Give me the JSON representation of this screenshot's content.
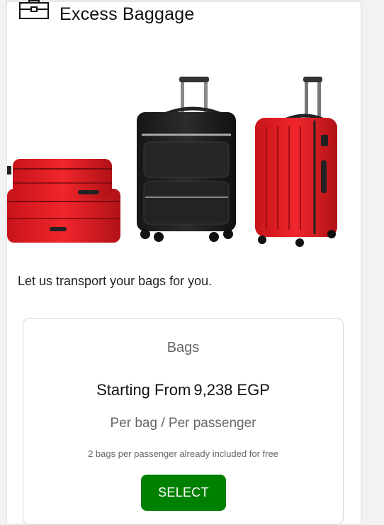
{
  "section": {
    "title": "Excess Baggage",
    "icon": "briefcase-icon",
    "tagline": "Let us transport your bags for you."
  },
  "hero": {
    "image": "luggage-group-illustration"
  },
  "offer": {
    "heading": "Bags",
    "price_prefix": "Starting From",
    "price_amount": "9,238",
    "price_currency": "EGP",
    "per_label": "Per bag / Per passenger",
    "included_note": "2 bags per passenger already included for free",
    "select_label": "SELECT"
  },
  "colors": {
    "select_button": "#008000",
    "suitcase_red": "#e42025",
    "suitcase_black": "#1f1f1f"
  }
}
